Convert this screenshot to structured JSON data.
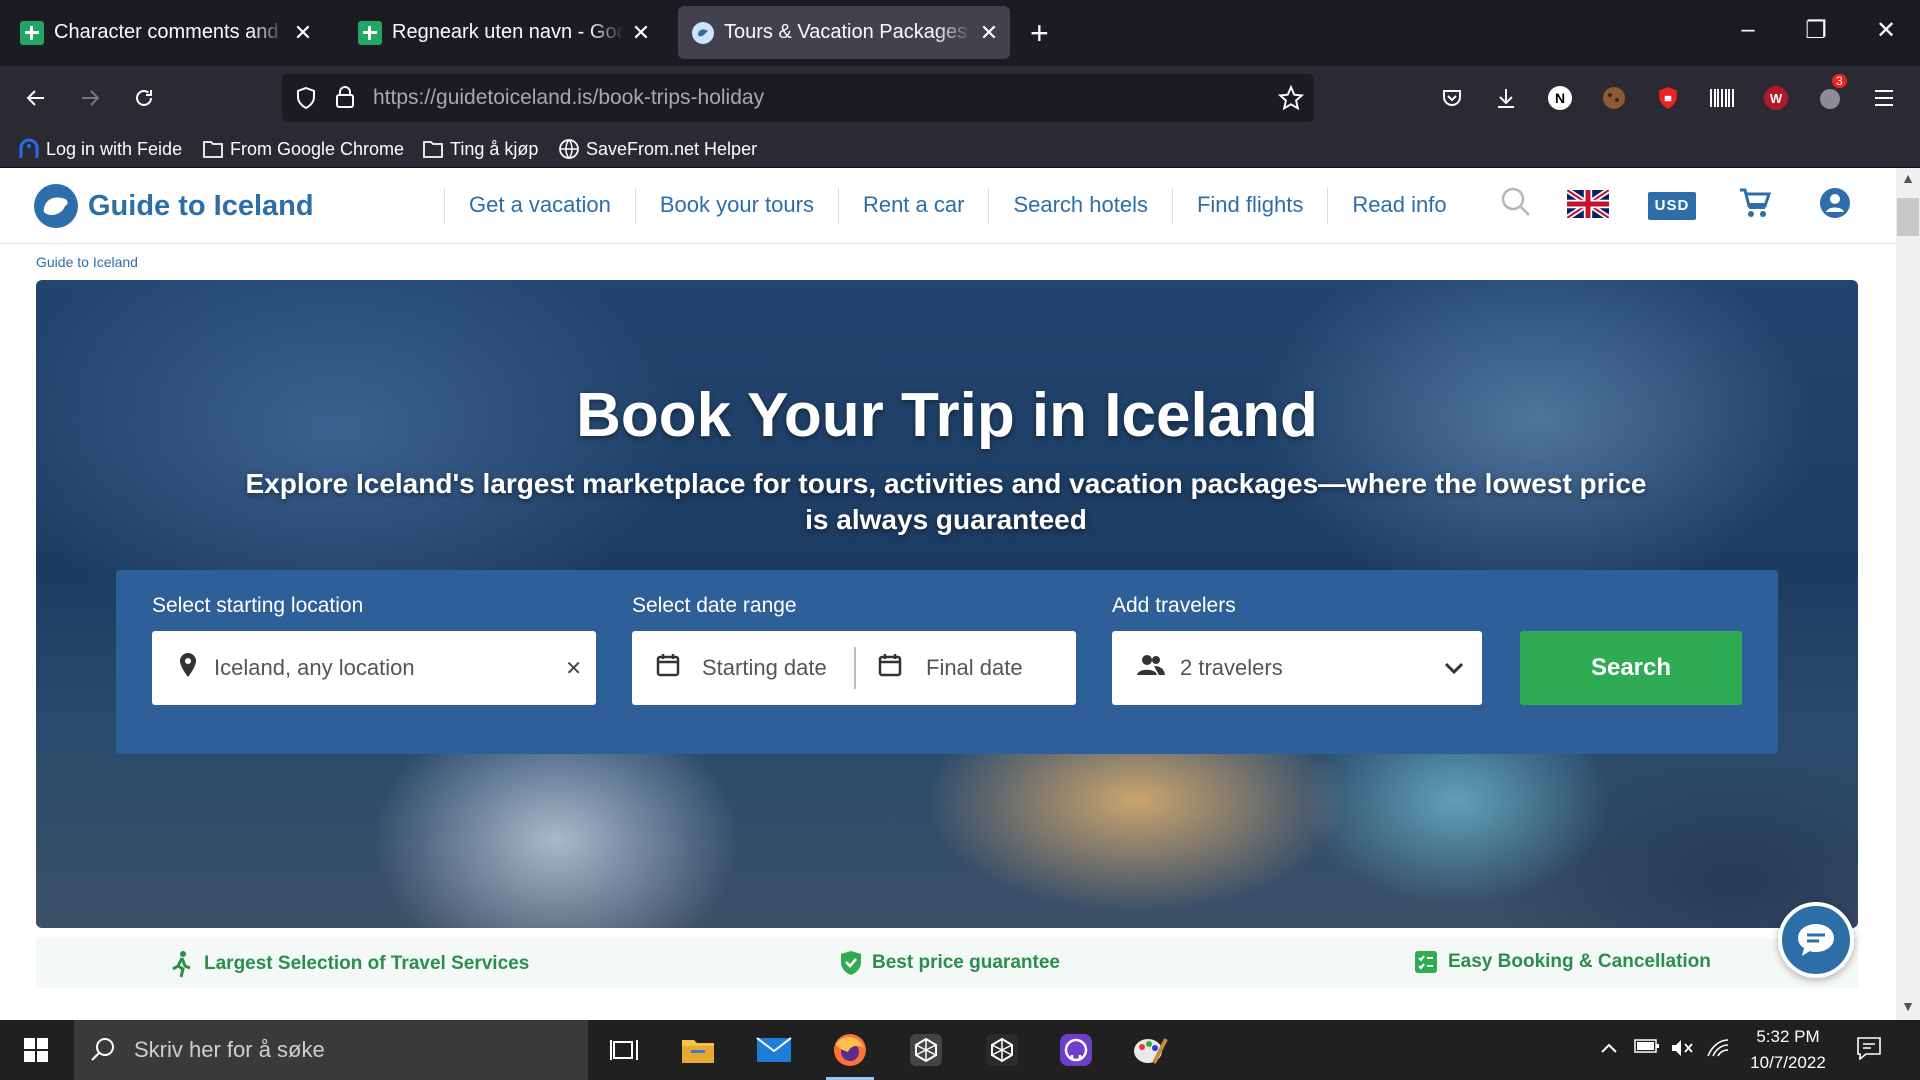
{
  "browser": {
    "tabs": [
      {
        "title": "Character comments and phrases",
        "icon": "sheets-icon",
        "active": false
      },
      {
        "title": "Regneark uten navn - Google Regneark",
        "icon": "sheets-icon",
        "active": false
      },
      {
        "title": "Tours & Vacation Packages in Iceland",
        "icon": "guide-to-iceland-favicon",
        "active": true
      }
    ],
    "url_host": "https://guidetoiceland.is",
    "url_path": "/book-trips-holiday",
    "extension_badge": "3",
    "bookmarks": [
      {
        "label": "Log in with Feide",
        "icon": "feide-icon"
      },
      {
        "label": "From Google Chrome",
        "icon": "folder-icon"
      },
      {
        "label": "Ting å kjøp",
        "icon": "folder-icon"
      },
      {
        "label": "SaveFrom.net Helper",
        "icon": "globe-icon"
      }
    ]
  },
  "site": {
    "brand": "Guide to Iceland",
    "nav": [
      "Get a vacation",
      "Book your tours",
      "Rent a car",
      "Search hotels",
      "Find flights",
      "Read info"
    ],
    "currency": "USD",
    "breadcrumb": "Guide to Iceland",
    "hero": {
      "title": "Book Your Trip in Iceland",
      "subtitle": "Explore Iceland's largest marketplace for tours, activities and vacation packages—where the lowest price is always guaranteed"
    },
    "search": {
      "location_label": "Select starting location",
      "location_value": "Iceland, any location",
      "date_label": "Select date range",
      "start_placeholder": "Starting date",
      "end_placeholder": "Final date",
      "travelers_label": "Add travelers",
      "travelers_value": "2 travelers",
      "button": "Search"
    },
    "features": [
      {
        "label": "Largest Selection of Travel Services",
        "icon": "hiker-icon"
      },
      {
        "label": "Best price guarantee",
        "icon": "shield-check-icon"
      },
      {
        "label": "Easy Booking & Cancellation",
        "icon": "checklist-icon"
      }
    ]
  },
  "taskbar": {
    "search_placeholder": "Skriv her for å søke",
    "time": "5:32 PM",
    "date": "10/7/2022"
  },
  "colors": {
    "brand_blue": "#2d6ea9",
    "search_green": "#2fab54",
    "panel_blue": "#2e5f99"
  }
}
